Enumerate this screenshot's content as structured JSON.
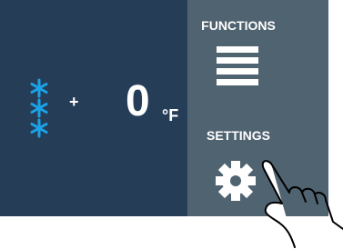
{
  "display": {
    "temperature": {
      "sign": "+",
      "value": "0",
      "unit": "°F"
    },
    "mode_icon": "snowflake-stack-icon"
  },
  "side_menu": {
    "functions": {
      "label": "FUNCTIONS",
      "icon": "hamburger-menu-icon"
    },
    "settings": {
      "label": "SETTINGS",
      "icon": "gear-icon"
    }
  },
  "colors": {
    "screen_background": "#263d57",
    "panel_background": "#506371",
    "snowflake": "#1aa3e8",
    "text": "#ffffff"
  },
  "overlay": {
    "pointer": "pointing-hand-icon"
  }
}
